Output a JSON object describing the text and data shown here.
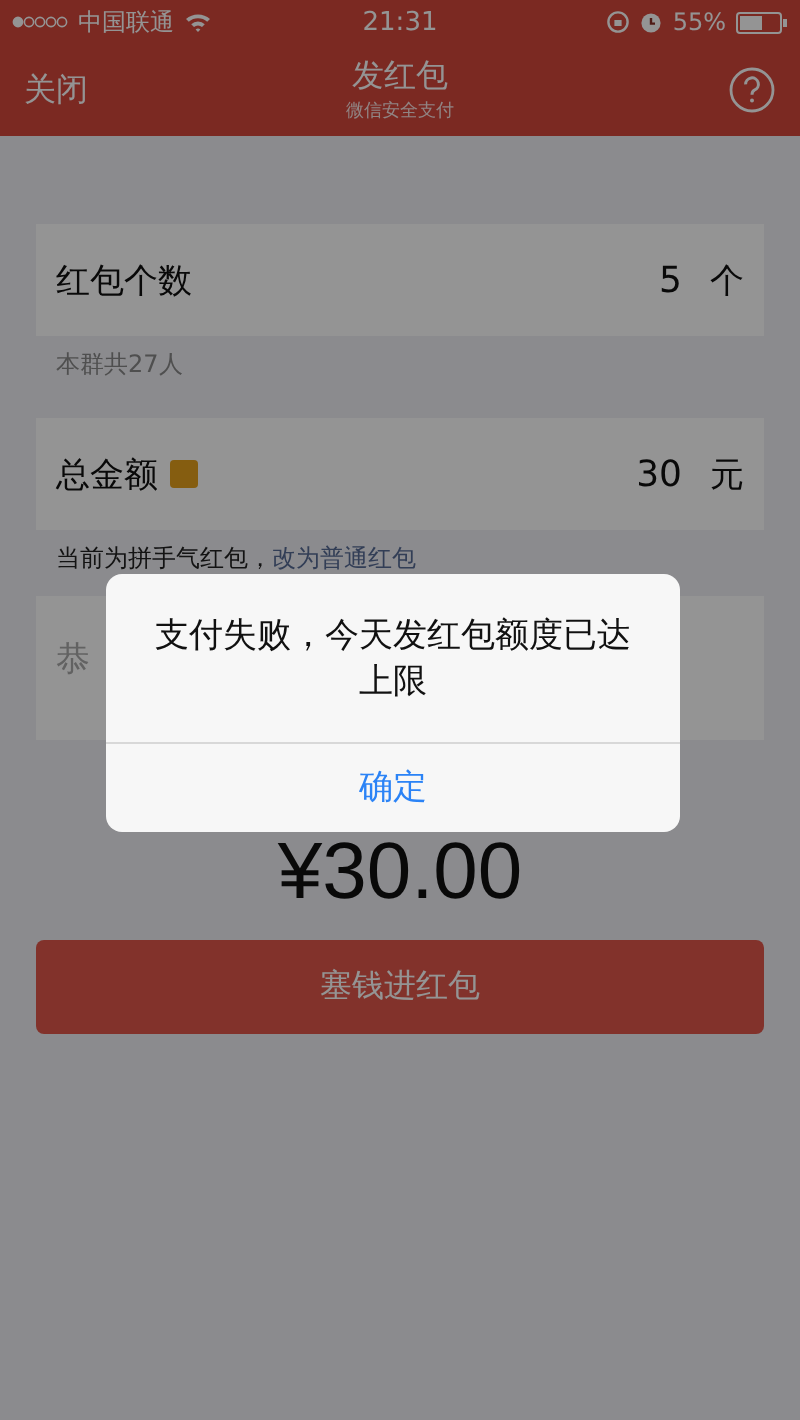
{
  "status_bar": {
    "carrier": "中国联通",
    "time": "21:31",
    "battery": "55%"
  },
  "nav": {
    "close": "关闭",
    "title": "发红包",
    "subtitle": "微信安全支付"
  },
  "count_row": {
    "label": "红包个数",
    "value": "5",
    "unit": "个"
  },
  "count_hint": "本群共27人",
  "amount_row": {
    "label": "总金额",
    "value": "30",
    "unit": "元"
  },
  "type_hint": {
    "text": "当前为拼手气红包，",
    "link": "改为普通红包"
  },
  "message": {
    "placeholder": "恭"
  },
  "total": "¥30.00",
  "submit": "塞钱进红包",
  "alert": {
    "message": "支付失败，今天发红包额度已达上限",
    "button": "确定"
  }
}
